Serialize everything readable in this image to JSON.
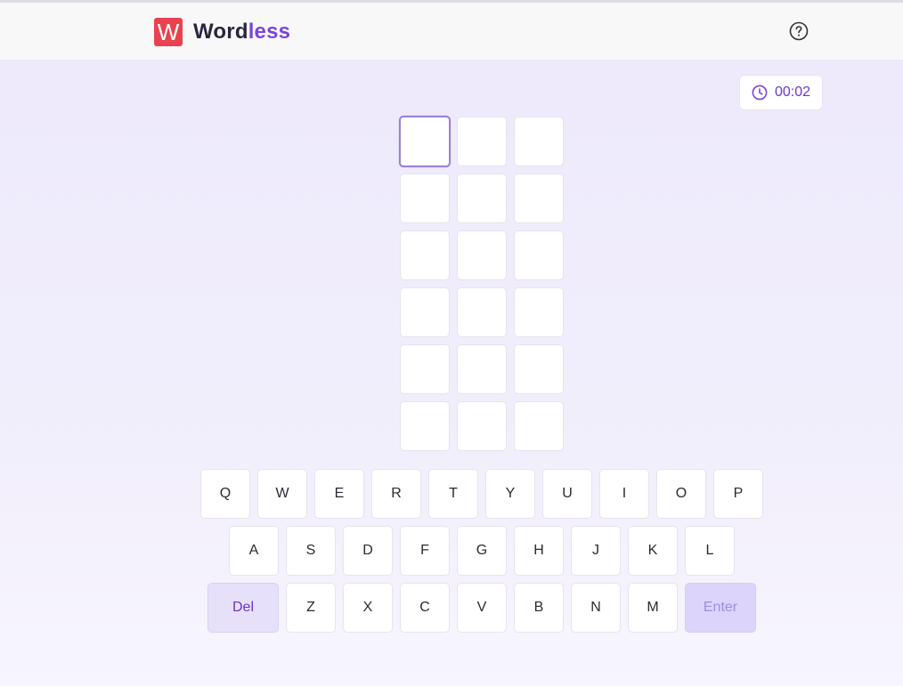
{
  "app": {
    "logo_letter": "W",
    "title_part1": "Word",
    "title_part2": "less",
    "brand_red": "#e9424e",
    "brand_purple": "#7a45d8"
  },
  "header": {
    "help_icon": "help-circle-icon"
  },
  "timer": {
    "icon": "clock-icon",
    "value": "00:02"
  },
  "board": {
    "rows": 6,
    "cols": 3,
    "active_cell": [
      0,
      0
    ],
    "letters": [
      [
        "",
        "",
        ""
      ],
      [
        "",
        "",
        ""
      ],
      [
        "",
        "",
        ""
      ],
      [
        "",
        "",
        ""
      ],
      [
        "",
        "",
        ""
      ],
      [
        "",
        "",
        ""
      ]
    ]
  },
  "keyboard": {
    "row1": [
      "Q",
      "W",
      "E",
      "R",
      "T",
      "Y",
      "U",
      "I",
      "O",
      "P"
    ],
    "row2": [
      "A",
      "S",
      "D",
      "F",
      "G",
      "H",
      "J",
      "K",
      "L"
    ],
    "row3": [
      "Z",
      "X",
      "C",
      "V",
      "B",
      "N",
      "M"
    ],
    "del_label": "Del",
    "enter_label": "Enter"
  }
}
